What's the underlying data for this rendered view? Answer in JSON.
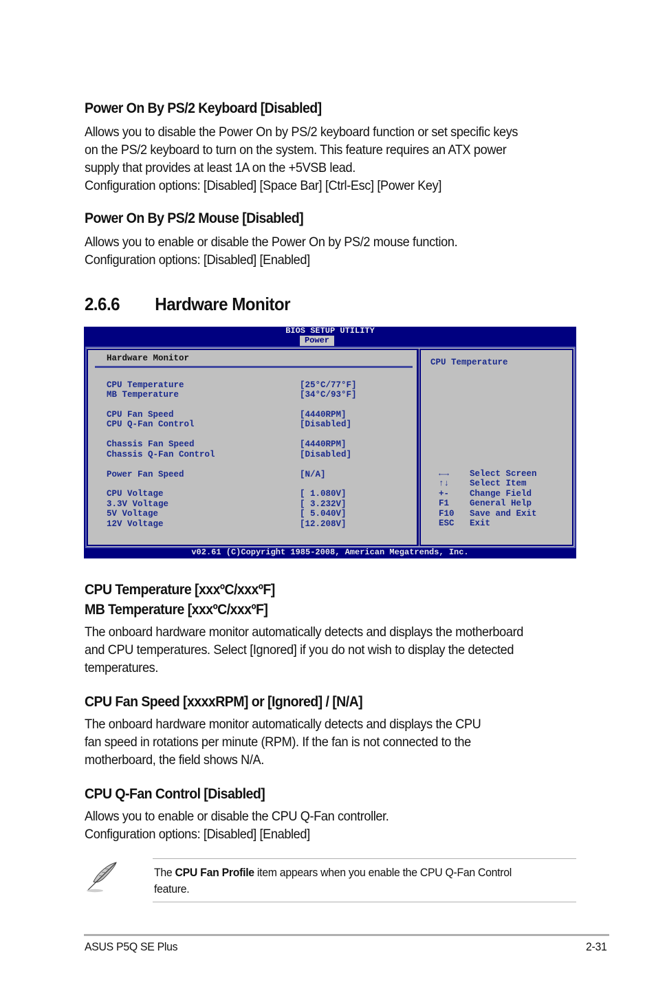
{
  "sections": {
    "keyboard": {
      "heading": "Power On By PS/2 Keyboard [Disabled]",
      "lines": [
        "Allows you to disable the Power On by PS/2 keyboard function or set specific keys",
        "on the PS/2 keyboard to turn on the system. This feature requires an ATX power",
        "supply that provides at least 1A on the +5VSB lead.",
        "Configuration options: [Disabled] [Space Bar] [Ctrl-Esc] [Power Key]"
      ]
    },
    "mouse": {
      "heading": "Power On By PS/2 Mouse [Disabled]",
      "lines": [
        "Allows you to enable or disable the Power On by PS/2 mouse function.",
        "Configuration options: [Disabled] [Enabled]"
      ]
    },
    "hardware_monitor": {
      "number": "2.6.6",
      "title": "Hardware Monitor"
    },
    "temperature": {
      "heading_line1": "CPU Temperature [xxxºC/xxxºF]",
      "heading_line2": "MB Temperature [xxxºC/xxxºF]",
      "lines": [
        "The onboard hardware monitor automatically detects and displays the motherboard",
        "and CPU temperatures. Select [Ignored] if you do not wish to display the detected",
        "temperatures."
      ]
    },
    "fan_speed": {
      "heading": "CPU Fan Speed [xxxxRPM] or [Ignored] / [N/A]",
      "lines": [
        "The onboard hardware monitor automatically detects and displays the CPU",
        "fan speed in rotations per minute (RPM). If the fan is not connected to the",
        "motherboard, the field shows N/A."
      ]
    },
    "qfan": {
      "heading": "CPU Q-Fan Control [Disabled]",
      "lines": [
        "Allows you to enable or disable the CPU Q-Fan controller.",
        "Configuration options: [Disabled] [Enabled]"
      ]
    }
  },
  "bios": {
    "title": "BIOS SETUP UTILITY",
    "active_tab": "Power",
    "section_title": "Hardware Monitor",
    "items": [
      {
        "label": "CPU Temperature",
        "value": "[25°C/77°F]"
      },
      {
        "label": "MB Temperature",
        "value": "[34°C/93°F]"
      },
      {
        "label": "CPU Fan Speed",
        "value": "[4440RPM]"
      },
      {
        "label": "CPU Q-Fan Control",
        "value": "[Disabled]"
      },
      {
        "label": "Chassis Fan Speed",
        "value": "[4440RPM]"
      },
      {
        "label": "Chassis Q-Fan Control",
        "value": "[Disabled]"
      },
      {
        "label": "Power Fan Speed",
        "value": "[N/A]"
      },
      {
        "label": "CPU Voltage",
        "value": "[ 1.080V]"
      },
      {
        "label": "3.3V Voltage",
        "value": "[ 3.232V]"
      },
      {
        "label": "5V Voltage",
        "value": "[ 5.040V]"
      },
      {
        "label": "12V Voltage",
        "value": "[12.208V]"
      }
    ],
    "help_title": "CPU Temperature",
    "keys": [
      {
        "key": "←→",
        "icon": "left-right-arrows-icon",
        "desc": "Select Screen"
      },
      {
        "key": "↑↓",
        "icon": "up-down-arrows-icon",
        "desc": "Select Item"
      },
      {
        "key": "+-",
        "desc": "Change Field"
      },
      {
        "key": "F1",
        "desc": "General Help"
      },
      {
        "key": "F10",
        "desc": "Save and Exit"
      },
      {
        "key": "ESC",
        "desc": "Exit"
      }
    ],
    "footer": "v02.61 (C)Copyright 1985-2008, American Megatrends, Inc.",
    "colors": {
      "background": "#000080",
      "panel": "#c0c0c0",
      "text": "#1a2a8c"
    }
  },
  "note": {
    "icon": "feather-pen-icon",
    "prefix": "The ",
    "bold": "CPU Fan Profile",
    "suffix": " item appears when you enable the CPU Q-Fan Control",
    "line2": "feature."
  },
  "footer": {
    "product": "ASUS P5Q SE Plus",
    "page": "2-31"
  }
}
